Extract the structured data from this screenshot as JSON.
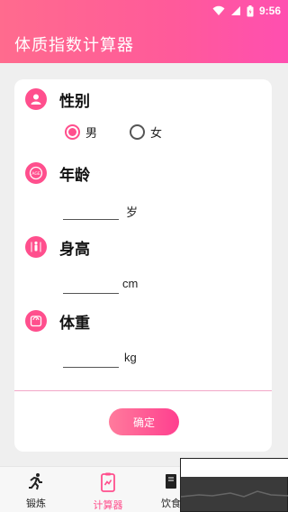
{
  "status_bar": {
    "time": "9:56"
  },
  "header": {
    "title": "体质指数计算器"
  },
  "form": {
    "gender": {
      "label": "性别",
      "options": [
        "男",
        "女"
      ],
      "selected": "男"
    },
    "age": {
      "label": "年龄",
      "unit": "岁",
      "value": ""
    },
    "height": {
      "label": "身高",
      "unit": "cm",
      "value": ""
    },
    "weight": {
      "label": "体重",
      "unit": "kg",
      "value": ""
    },
    "confirm_label": "确定"
  },
  "tabs": [
    {
      "label": "锻炼",
      "active": false
    },
    {
      "label": "计算器",
      "active": true
    },
    {
      "label": "饮食",
      "active": false
    }
  ],
  "colors": {
    "accent": "#ff4f8d",
    "header_start": "#ff6b8e",
    "header_end": "#ff4fb0"
  },
  "icons": {
    "gender": "person-icon",
    "age": "age-icon",
    "height": "height-icon",
    "weight": "scale-icon"
  }
}
